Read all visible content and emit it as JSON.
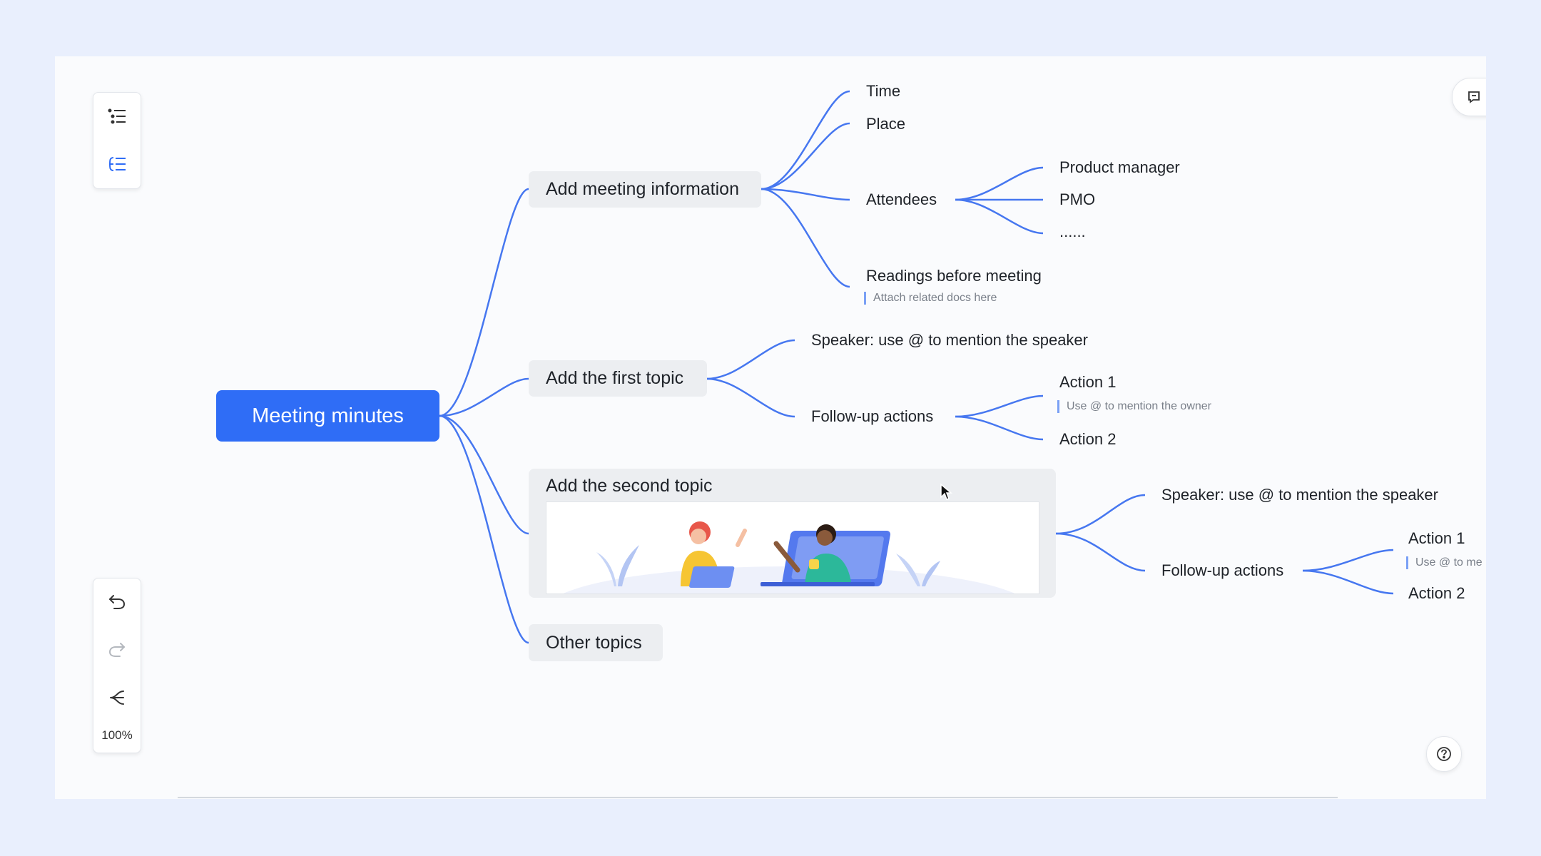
{
  "mindmap": {
    "root": "Meeting minutes",
    "topic_info": {
      "label": "Add meeting information",
      "time": "Time",
      "place": "Place",
      "attendees": "Attendees",
      "attendee_items": [
        "Product manager",
        "PMO",
        "......"
      ],
      "readings": "Readings before meeting",
      "readings_note": "Attach related docs here"
    },
    "topic_first": {
      "label": "Add the first topic",
      "speaker": "Speaker: use @ to mention the speaker",
      "followup": "Follow-up actions",
      "action1": "Action 1",
      "action1_note": "Use @ to mention the owner",
      "action2": "Action 2"
    },
    "topic_second": {
      "label": "Add the second topic",
      "speaker": "Speaker: use @ to mention the speaker",
      "followup": "Follow-up actions",
      "action1": "Action 1",
      "action1_note": "Use @ to me",
      "action2": "Action 2"
    },
    "topic_other": {
      "label": "Other topics"
    }
  },
  "toolbar": {
    "zoom": "100%",
    "icons": [
      "outline-list-icon",
      "mindmap-structure-icon",
      "undo-icon",
      "redo-icon",
      "layout-icon"
    ]
  },
  "colors": {
    "accent": "#2f6df6",
    "link": "#4677f0",
    "node_bg": "#eceef1"
  }
}
